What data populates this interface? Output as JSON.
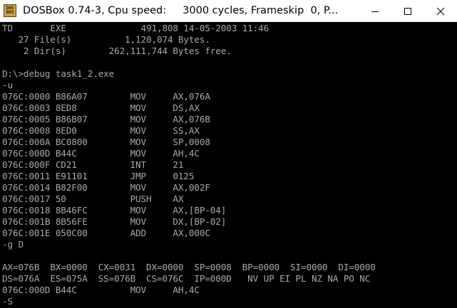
{
  "window": {
    "title": "DOSBox 0.74-3, Cpu speed:     3000 cycles, Frameskip  0, P...",
    "icon_text_top": "DOS",
    "icon_text_bottom": "BOX",
    "icons": {
      "app": "dosbox-icon",
      "minimize": "minimize-icon",
      "maximize": "maximize-icon",
      "close": "close-icon"
    }
  },
  "colors": {
    "screen_bg": "#000000",
    "screen_text": "#aaaaaa",
    "titlebar_bg": "#ffffff"
  },
  "console": {
    "lines": [
      "TD       EXE              491,808 14-05-2003 11:46",
      "   27 File(s)          1,120,074 Bytes.",
      "    2 Dir(s)        262,111,744 Bytes free.",
      "",
      "D:\\>debug task1_2.exe",
      "-u",
      "076C:0000 B86A07        MOV     AX,076A",
      "076C:0003 8ED8          MOV     DS,AX",
      "076C:0005 B86B07        MOV     AX,076B",
      "076C:0008 8ED0          MOV     SS,AX",
      "076C:000A BC0800        MOV     SP,0008",
      "076C:000D B44C          MOV     AH,4C",
      "076C:000F CD21          INT     21",
      "076C:0011 E91101        JMP     0125",
      "076C:0014 B82F00        MOV     AX,002F",
      "076C:0017 50            PUSH    AX",
      "076C:0018 8B46FC        MOV     AX,[BP-04]",
      "076C:001B 8B56FE        MOV     DX,[BP-02]",
      "076C:001E 050C00        ADD     AX,000C",
      "-g D",
      "",
      "AX=076B  BX=0000  CX=0031  DX=0000  SP=0008  BP=0000  SI=0000  DI=0000",
      "DS=076A  ES=075A  SS=076B  CS=076C  IP=000D   NV UP EI PL NZ NA PO NC",
      "076C:000D B44C          MOV     AH,4C",
      "-S"
    ]
  }
}
